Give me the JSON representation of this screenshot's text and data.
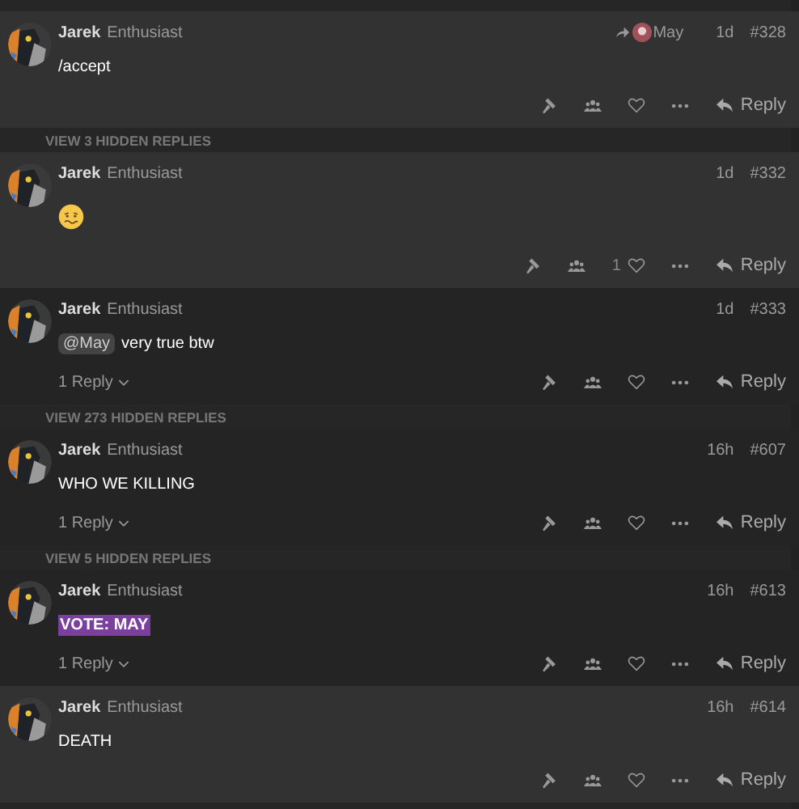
{
  "stream": [
    {
      "kind": "gap"
    },
    {
      "kind": "post",
      "highlighted": true,
      "author": "Jarek",
      "title": "Enthusiast",
      "reply_to": "May",
      "age": "1d",
      "number": "#328",
      "body": [
        {
          "kind": "text",
          "text": "/accept"
        }
      ],
      "action": "Reply"
    },
    {
      "kind": "gap",
      "label": "VIEW 3 HIDDEN REPLIES"
    },
    {
      "kind": "post",
      "highlighted": true,
      "author": "Jarek",
      "title": "Enthusiast",
      "age": "1d",
      "number": "#332",
      "body": [
        {
          "kind": "emoji"
        }
      ],
      "likes": "1",
      "action": "Reply"
    },
    {
      "kind": "post",
      "highlighted": false,
      "author": "Jarek",
      "title": "Enthusiast",
      "age": "1d",
      "number": "#333",
      "body": [
        {
          "kind": "mention",
          "text": "@May"
        },
        {
          "kind": "text",
          "text": "very true btw"
        }
      ],
      "replies": "1 Reply",
      "action": "Reply"
    },
    {
      "kind": "gap",
      "label": "VIEW 273 HIDDEN REPLIES"
    },
    {
      "kind": "post",
      "highlighted": false,
      "author": "Jarek",
      "title": "Enthusiast",
      "age": "16h",
      "number": "#607",
      "body": [
        {
          "kind": "text",
          "text": "WHO WE KILLING"
        }
      ],
      "replies": "1 Reply",
      "action": "Reply"
    },
    {
      "kind": "gap",
      "label": "VIEW 5 HIDDEN REPLIES"
    },
    {
      "kind": "post",
      "highlighted": false,
      "author": "Jarek",
      "title": "Enthusiast",
      "age": "16h",
      "number": "#613",
      "body": [
        {
          "kind": "highlight",
          "text": "VOTE: MAY"
        }
      ],
      "replies": "1 Reply",
      "action": "Reply"
    },
    {
      "kind": "post",
      "highlighted": true,
      "author": "Jarek",
      "title": "Enthusiast",
      "age": "16h",
      "number": "#614",
      "body": [
        {
          "kind": "text",
          "text": "DEATH"
        }
      ],
      "action": "Reply"
    },
    {
      "kind": "gap"
    }
  ]
}
